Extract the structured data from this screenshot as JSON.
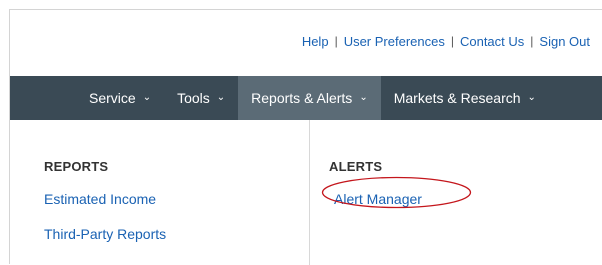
{
  "utility_links": {
    "help": "Help",
    "separator": "|",
    "user_preferences": "User Preferences",
    "contact_us": "Contact Us",
    "sign_out": "Sign Out"
  },
  "nav": {
    "items": [
      {
        "label": "Service",
        "chevron": "⌄"
      },
      {
        "label": "Tools",
        "chevron": "⌄"
      },
      {
        "label": "Reports & Alerts",
        "chevron": "⌄"
      },
      {
        "label": "Markets & Research",
        "chevron": "⌄"
      }
    ],
    "active_index": 2,
    "background": "#3a4a55",
    "active_background": "#5b6b76"
  },
  "dropdown": {
    "reports": {
      "heading": "REPORTS",
      "links": [
        "Estimated Income",
        "Third-Party Reports"
      ]
    },
    "alerts": {
      "heading": "ALERTS",
      "links": [
        "Alert Manager"
      ],
      "highlight_color": "#c4161c"
    }
  },
  "colors": {
    "link": "#1a62b3",
    "heading": "#333333"
  }
}
